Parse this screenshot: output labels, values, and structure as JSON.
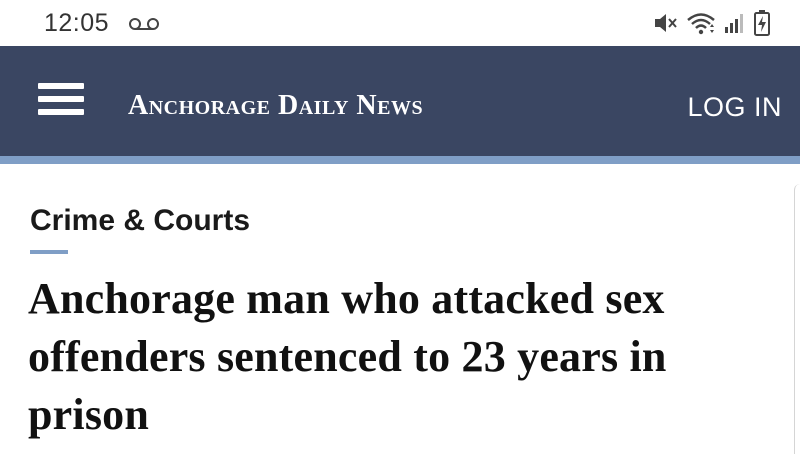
{
  "status_bar": {
    "time": "12:05",
    "icons": [
      "voicemail-icon",
      "mute-icon",
      "wifi-icon",
      "signal-icon",
      "battery-charging-icon"
    ]
  },
  "header": {
    "logo_text": "Anchorage Daily News",
    "login_label": "LOG IN",
    "menu_icon": "hamburger-menu-icon",
    "background_color": "#3a4662",
    "accent_color": "#7f9ec6"
  },
  "article": {
    "section": "Crime & Courts",
    "headline": "Anchorage man who attacked sex offenders sentenced to 23 years in prison"
  }
}
